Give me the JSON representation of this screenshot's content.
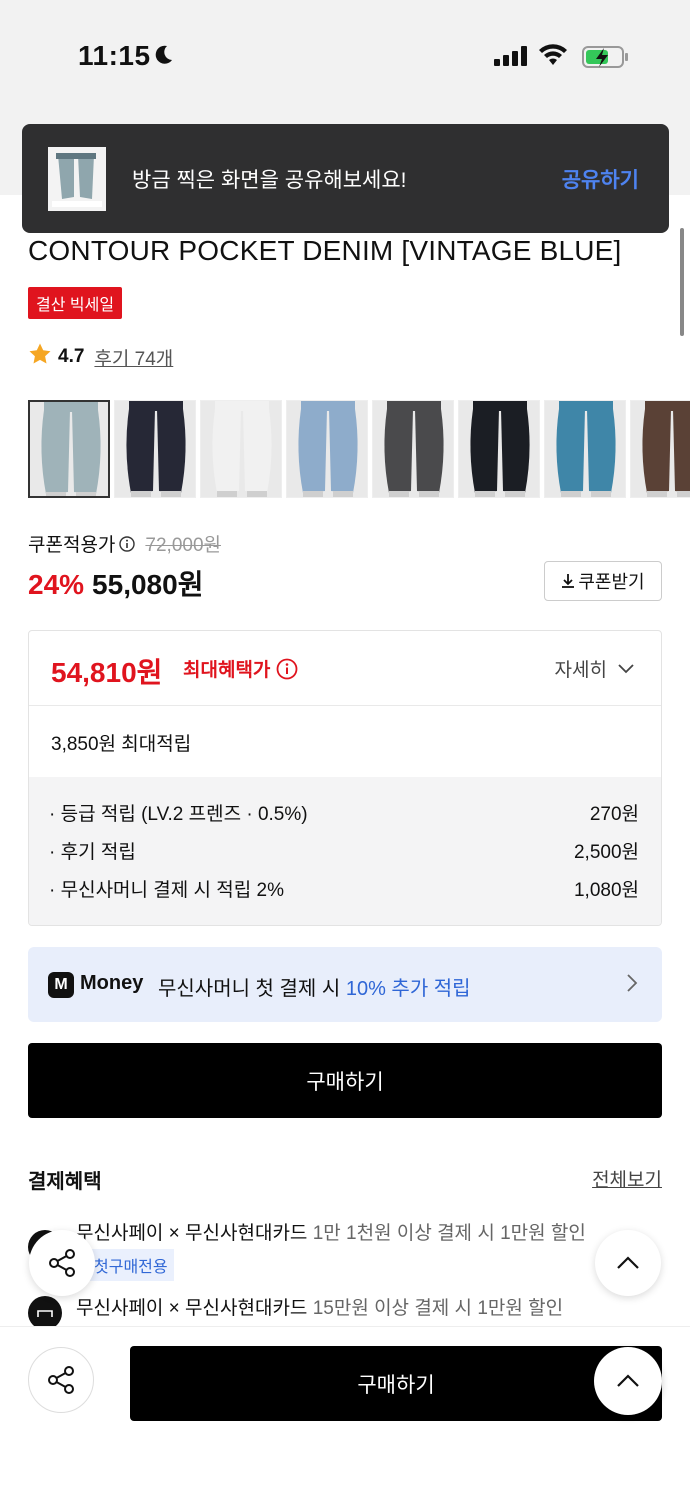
{
  "status_bar": {
    "time": "11:15",
    "icons": [
      "moon-icon",
      "signal-icon",
      "wifi-icon",
      "battery-charging-icon"
    ]
  },
  "toast": {
    "message": "방금 찍은 화면을 공유해보세요!",
    "action": "공유하기"
  },
  "product": {
    "title": "CONTOUR POCKET DENIM [VINTAGE BLUE]",
    "badge": "결산 빅세일",
    "rating": "4.7",
    "reviews": "후기 74개",
    "thumbnails": [
      {
        "color": "#9fb3b9"
      },
      {
        "color": "#262836"
      },
      {
        "color": "#f1f1f1"
      },
      {
        "color": "#8eaccb"
      },
      {
        "color": "#4a4a4c"
      },
      {
        "color": "#1b1e24"
      },
      {
        "color": "#3f86a8"
      },
      {
        "color": "#5a4136"
      }
    ]
  },
  "pricing": {
    "coupon_label": "쿠폰적용가",
    "original": "72,000원",
    "discount": "24%",
    "price": "55,080원",
    "coupon_button": "쿠폰받기"
  },
  "benefits": {
    "max_price": "54,810원",
    "max_label": "최대혜택가",
    "detail": "자세히",
    "points_total": "3,850원 최대적립",
    "rows": [
      {
        "label": "· 등급 적립 (LV.2 프렌즈 · 0.5%)",
        "value": "270원"
      },
      {
        "label": "· 후기 적립",
        "value": "2,500원"
      },
      {
        "label": "· 무신사머니 결제 시 적립 2%",
        "value": "1,080원"
      }
    ]
  },
  "money": {
    "logo": "M",
    "brand": "Money",
    "text": "무신사머니 첫 결제 시",
    "highlight": "10% 추가 적립"
  },
  "buy_label": "구매하기",
  "payment": {
    "heading": "결제혜택",
    "view_all": "전체보기",
    "items": [
      {
        "title": "무신사페이 × 무신사현대카드",
        "desc": "1만 1천원 이상 결제 시 1만원 할인"
      },
      {
        "title": "무신사페이 × 무신사현대카드",
        "desc": "15만원 이상 결제 시 1만원 할인"
      }
    ],
    "tag": "첫구매전용"
  },
  "bottom_bar": {
    "buy_label": "구매하기"
  }
}
